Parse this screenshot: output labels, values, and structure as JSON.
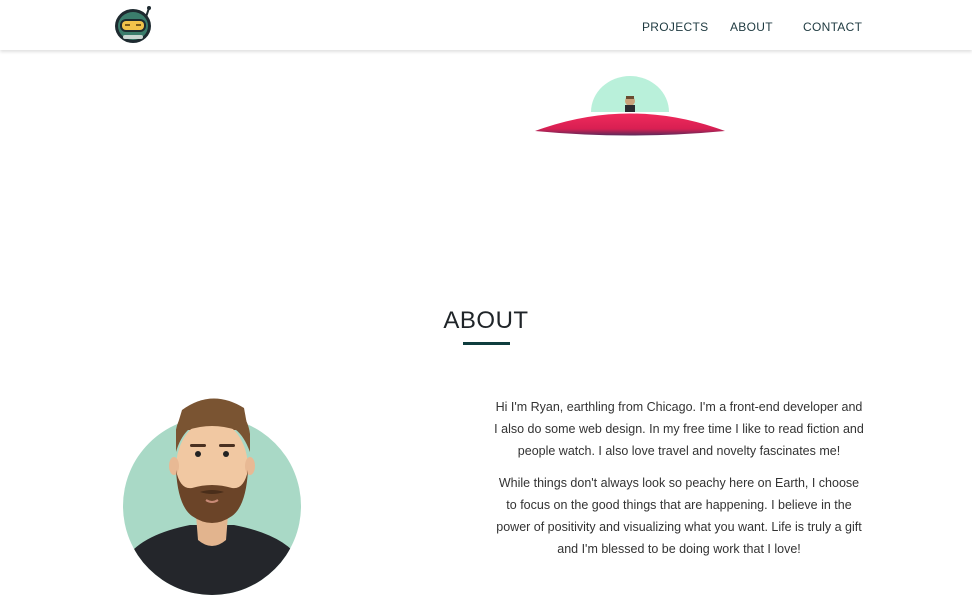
{
  "nav": {
    "logo_icon": "astronaut-helmet-icon",
    "links": [
      "PROJECTS",
      "ABOUT",
      "CONTACT"
    ]
  },
  "hero": {
    "illustration": "ufo-icon"
  },
  "about": {
    "title": "ABOUT",
    "avatar_icon": "bearded-man-avatar",
    "paragraphs": [
      "Hi I'm Ryan, earthling from Chicago. I'm a front-end developer and I also do some web design. In my free time I like to read fiction and people watch. I also love travel and novelty fascinates me!",
      "While things don't always look so peachy here on Earth, I choose to focus on the good things that are happening. I believe in the power of positivity and visualizing what you want. Life is truly a gift and I'm blessed to be doing work that I love!"
    ]
  },
  "colors": {
    "nav_text": "#1e3a40",
    "accent_underline": "#0f3d3e",
    "ufo_body": "#e8245a",
    "ufo_dome": "#b4efd8",
    "avatar_bg": "#a8d8c8"
  }
}
